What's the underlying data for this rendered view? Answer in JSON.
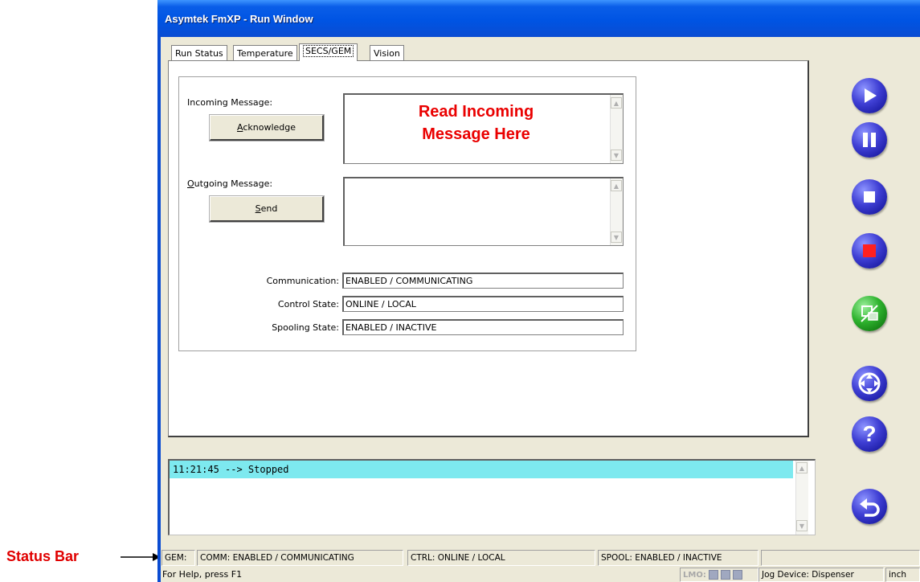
{
  "window": {
    "title": "Asymtek FmXP - Run Window"
  },
  "tabs": [
    {
      "label": "Run Status"
    },
    {
      "label": "Temperature"
    },
    {
      "label": "SECS/GEM"
    },
    {
      "label": "Vision"
    }
  ],
  "secs_gem": {
    "incoming_label": "Incoming Message:",
    "acknowledge_button": "Acknowledge",
    "outgoing_label": "Outgoing Message:",
    "send_button": "Send",
    "incoming_overlay": [
      "Read Incoming",
      "Message Here"
    ],
    "communication_label": "Communication:",
    "communication_value": "ENABLED / COMMUNICATING",
    "control_label": "Control State:",
    "control_value": "ONLINE / LOCAL",
    "spooling_label": "Spooling State:",
    "spooling_value": "ENABLED / INACTIVE"
  },
  "log": {
    "line": "11:21:45 --> Stopped",
    "highlight_color": "#7de9ef"
  },
  "status_bar": {
    "gem": "GEM:",
    "comm": "COMM: ENABLED / COMMUNICATING",
    "ctrl": "CTRL: ONLINE / LOCAL",
    "spool": "SPOOL: ENABLED / INACTIVE",
    "help": "For Help, press F1",
    "lmo": "LMO:",
    "jog": "Jog Device: Dispenser",
    "units": "inch"
  },
  "annotation": {
    "label": "Status Bar",
    "color": "#e00000"
  },
  "toolbar_icons": [
    "play-icon",
    "pause-icon",
    "stop-icon",
    "abort-stop-icon",
    "vision-camera-icon",
    "jog-directions-icon",
    "help-icon",
    "exit-back-icon"
  ]
}
